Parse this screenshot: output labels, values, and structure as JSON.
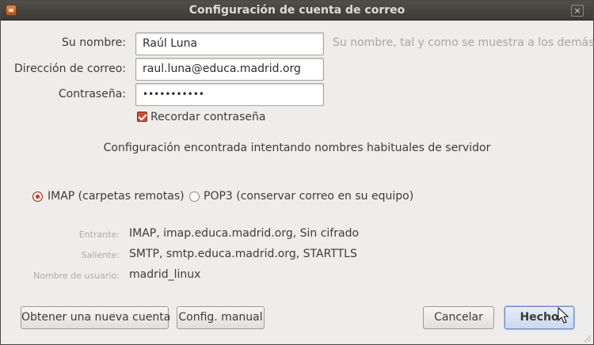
{
  "window": {
    "title": "Configuración de cuenta de correo",
    "close_glyph": "×"
  },
  "form": {
    "name_label": "Su nombre:",
    "name_value": "Raúl Luna",
    "name_hint": "Su nombre, tal y como se muestra a los demás",
    "email_label": "Dirección de correo:",
    "email_value": "raul.luna@educa.madrid.org",
    "password_label": "Contraseña:",
    "password_value": "•••••••••••",
    "remember_label": "Recordar contraseña",
    "remember_checked": true
  },
  "status_text": "Configuración encontrada intentando nombres habituales de servidor",
  "protocols": [
    {
      "label": "IMAP (carpetas remotas)",
      "selected": true
    },
    {
      "label": "POP3 (conservar correo en su equipo)",
      "selected": false
    }
  ],
  "server_info": [
    {
      "label": "Entrante:",
      "value": "IMAP, imap.educa.madrid.org, Sin cifrado"
    },
    {
      "label": "Saliente:",
      "value": "SMTP, smtp.educa.madrid.org, STARTTLS"
    },
    {
      "label": "Nombre de usuario:",
      "value": "madrid_linux"
    }
  ],
  "buttons": {
    "new_account": "Obtener una nueva cuenta",
    "manual_config": "Config. manual",
    "cancel": "Cancelar",
    "done": "Hecho"
  },
  "colors": {
    "titlebar": "#3c3b37",
    "accent": "#c8513a",
    "default_button": "#cbd8ee"
  },
  "icons": {
    "app": "thunderbird-icon",
    "close": "close-icon",
    "cursor": "mouse-pointer-icon"
  }
}
